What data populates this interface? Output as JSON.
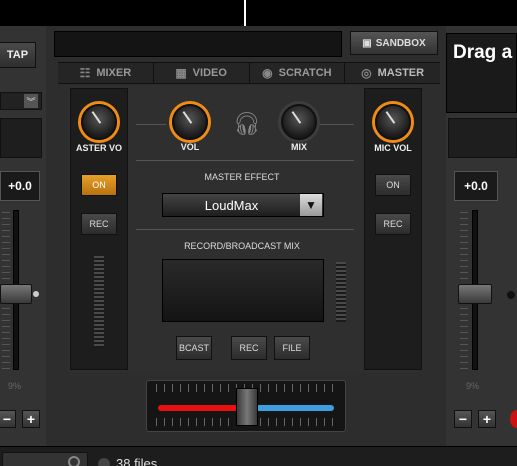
{
  "left_deck": {
    "tap_label": "TAP",
    "pitch_value": "+0.0",
    "pitch_range": "9%",
    "minus": "−",
    "plus": "+"
  },
  "right_deck": {
    "drag_text": "Drag a",
    "pitch_value": "+0.0",
    "pitch_range": "9%",
    "minus": "−",
    "plus": "+"
  },
  "toolbar": {
    "sandbox_label": "SANDBOX"
  },
  "tabs": [
    {
      "label": "MIXER",
      "icon": "mixer-icon"
    },
    {
      "label": "VIDEO",
      "icon": "film-icon"
    },
    {
      "label": "SCRATCH",
      "icon": "vinyl-icon"
    },
    {
      "label": "MASTER",
      "icon": "target-icon"
    }
  ],
  "mixer": {
    "master_vol_label": "ASTER VO",
    "vol_label": "VOL",
    "mix_label": "MIX",
    "mic_vol_label": "MIC VOL",
    "master_on_label": "ON",
    "master_rec_label": "REC",
    "mic_on_label": "ON",
    "mic_rec_label": "REC",
    "master_effect_title": "MASTER EFFECT",
    "master_effect_value": "LoudMax",
    "record_title": "RECORD/BROADCAST MIX",
    "bcast_label": "BCAST",
    "rec_label": "REC",
    "file_label": "FILE"
  },
  "browser": {
    "files_count": "38 files"
  },
  "colors": {
    "accent_orange": "#f08c14",
    "on_button": "#d08a1c",
    "crossfader_left": "#e81010",
    "crossfader_right": "#3d9fe0"
  }
}
